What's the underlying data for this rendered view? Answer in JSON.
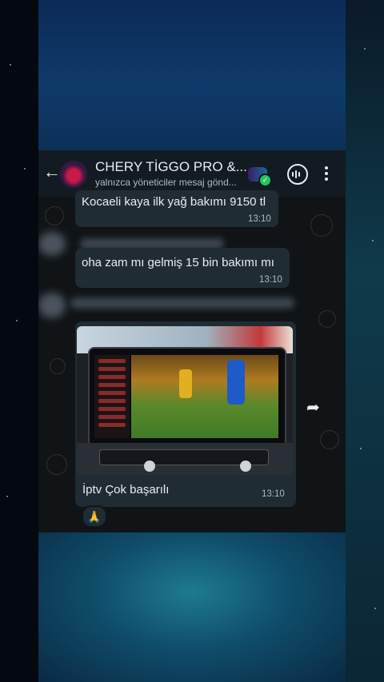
{
  "header": {
    "title": "CHERY TİGGO PRO &...",
    "subtitle": "yalnızca yöneticiler mesaj gönd...",
    "back_icon": "back-arrow-icon",
    "avatar_icon": "group-avatar-icon",
    "community_icon": "community-icon",
    "verified_icon": "check-icon",
    "voice_icon": "voice-chat-icon",
    "menu_icon": "more-vertical-icon"
  },
  "messages": [
    {
      "text": "Kocaeli kaya ilk yağ bakımı 9150 tl",
      "time": "13:10"
    },
    {
      "text": "oha zam mı gelmiş 15 bin bakımı mı",
      "time": "13:10"
    },
    {
      "caption": "İptv Çok başarılı",
      "time": "13:10",
      "media": "photo-of-car-screen"
    }
  ],
  "reaction": {
    "emoji": "🙏"
  },
  "colors": {
    "chat_bg": "#101417",
    "bubble_bg": "#202c33",
    "header_bg": "#121b22",
    "text_primary": "#e9edef",
    "text_secondary": "#aebac1",
    "verified": "#22c55e"
  }
}
